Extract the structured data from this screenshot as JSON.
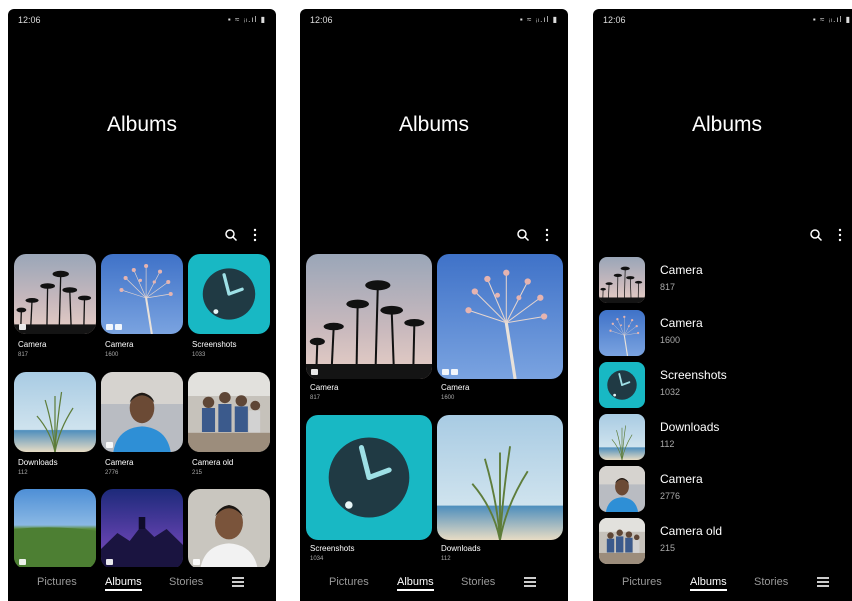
{
  "status": {
    "time": "12:06",
    "icons": "▪ ≈ ᵢₗ.ıl ▮"
  },
  "page_title": "Albums",
  "icons": {
    "search": "search-icon",
    "more": "more-vert-icon",
    "menu": "hamburger-menu-icon"
  },
  "nav": {
    "pictures": "Pictures",
    "albums": "Albums",
    "stories": "Stories"
  },
  "phone1": {
    "albums": [
      {
        "name": "Camera",
        "count": "817"
      },
      {
        "name": "Camera",
        "count": "1600"
      },
      {
        "name": "Screenshots",
        "count": "1033"
      },
      {
        "name": "Downloads",
        "count": "112"
      },
      {
        "name": "Camera",
        "count": "2776"
      },
      {
        "name": "Camera old",
        "count": "215"
      }
    ]
  },
  "phone2": {
    "albums": [
      {
        "name": "Camera",
        "count": "817"
      },
      {
        "name": "Camera",
        "count": "1600"
      },
      {
        "name": "Screenshots",
        "count": "1034"
      },
      {
        "name": "Downloads",
        "count": "112"
      }
    ]
  },
  "phone3": {
    "albums": [
      {
        "name": "Camera",
        "count": "817"
      },
      {
        "name": "Camera",
        "count": "1600"
      },
      {
        "name": "Screenshots",
        "count": "1032"
      },
      {
        "name": "Downloads",
        "count": "112"
      },
      {
        "name": "Camera",
        "count": "2776"
      },
      {
        "name": "Camera old",
        "count": "215"
      }
    ]
  }
}
